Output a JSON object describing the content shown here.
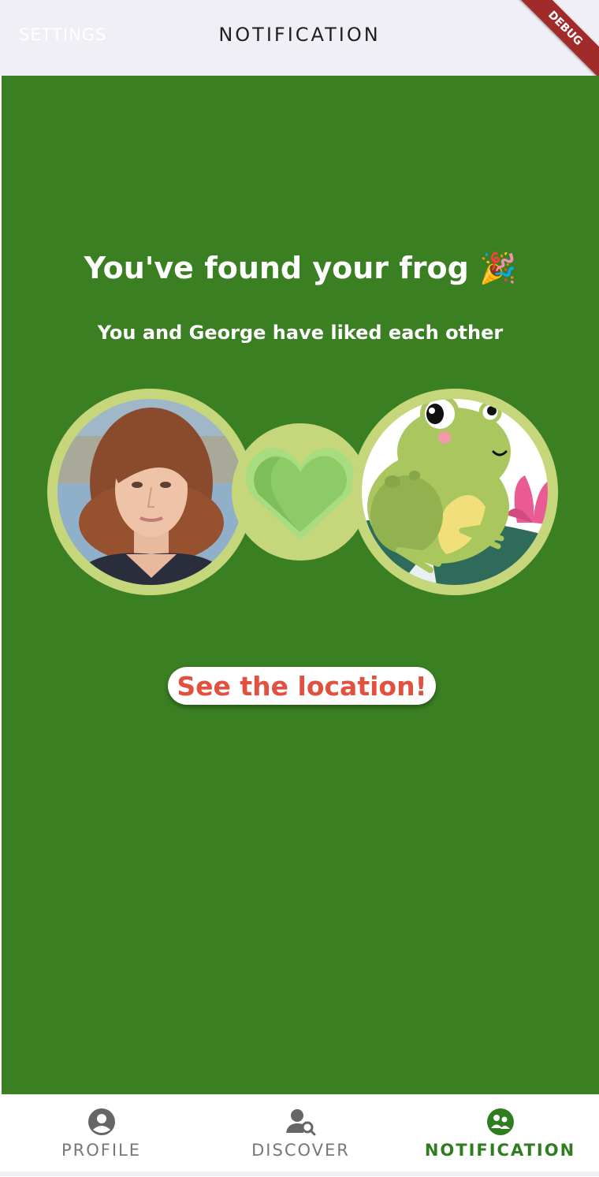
{
  "appbar": {
    "left_action": "SETTINGS",
    "title": "NOTIFICATION",
    "debug_banner": "DEBUG"
  },
  "match": {
    "headline": "You've found your frog 🎉",
    "subline": "You and George have liked each other",
    "button_label": "See the location!"
  },
  "nav": {
    "items": [
      {
        "label": "PROFILE",
        "icon": "profile-icon"
      },
      {
        "label": "DISCOVER",
        "icon": "discover-icon"
      },
      {
        "label": "NOTIFICATION",
        "icon": "notification-icon"
      }
    ],
    "active_index": 2
  },
  "colors": {
    "background_green": "#3a7f22",
    "ring": "#c5d77a",
    "heart": "#8ccb66",
    "button_text": "#e25040",
    "active_nav": "#2f7d20",
    "inactive_nav": "#777777"
  }
}
